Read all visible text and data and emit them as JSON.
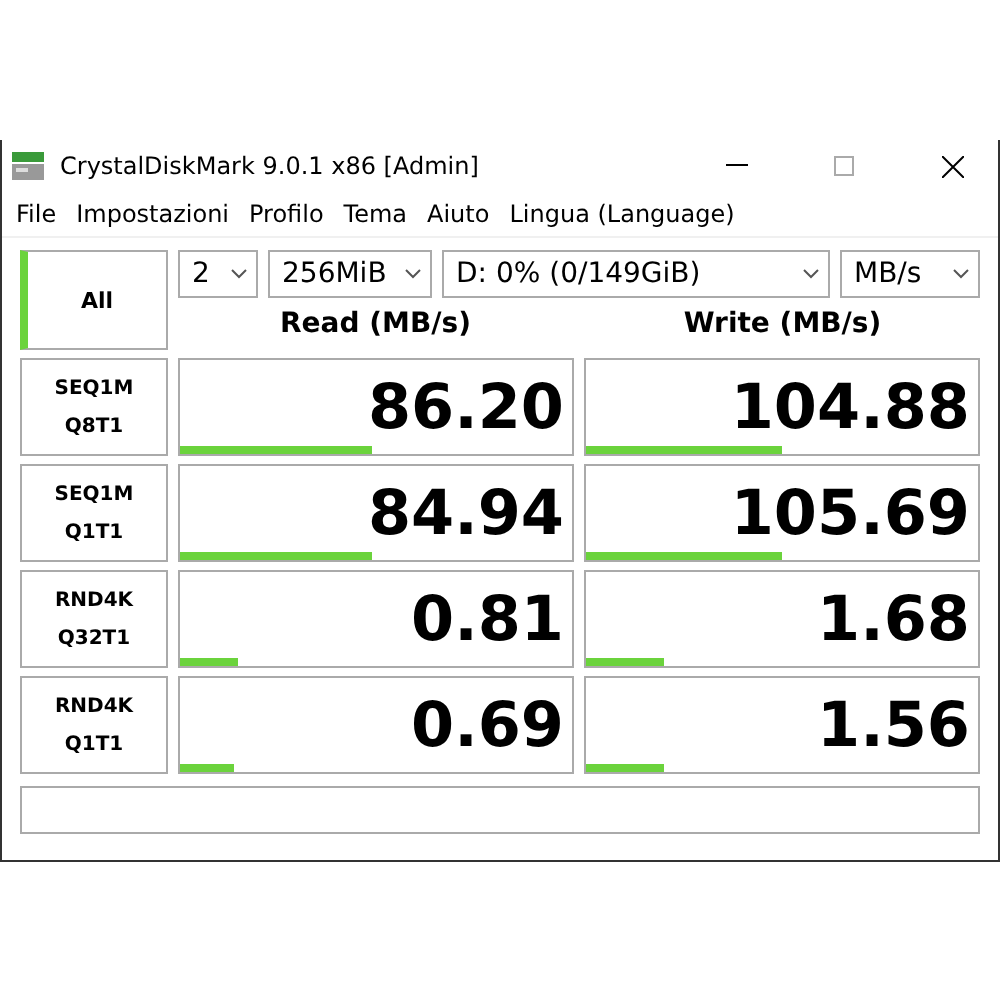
{
  "window": {
    "title": "CrystalDiskMark 9.0.1 x86 [Admin]"
  },
  "menu": [
    "File",
    "Impostazioni",
    "Profilo",
    "Tema",
    "Aiuto",
    "Lingua (Language)"
  ],
  "all_button": {
    "label": "All"
  },
  "selectors": [
    {
      "value": "2"
    },
    {
      "value": "256MiB"
    },
    {
      "value": "D: 0% (0/149GiB)"
    },
    {
      "value": "MB/s"
    }
  ],
  "columns": [
    "Read (MB/s)",
    "Write (MB/s)"
  ],
  "tests": [
    {
      "name": [
        "SEQ1M",
        "Q8T1"
      ],
      "read": {
        "value": "86.20",
        "level": 0.49
      },
      "write": {
        "value": "104.88",
        "level": 0.5
      }
    },
    {
      "name": [
        "SEQ1M",
        "Q1T1"
      ],
      "read": {
        "value": "84.94",
        "level": 0.49
      },
      "write": {
        "value": "105.69",
        "level": 0.5
      }
    },
    {
      "name": [
        "RND4K",
        "Q32T1"
      ],
      "read": {
        "value": "0.81",
        "level": 0.15
      },
      "write": {
        "value": "1.68",
        "level": 0.2
      }
    },
    {
      "name": [
        "RND4K",
        "Q1T1"
      ],
      "read": {
        "value": "0.69",
        "level": 0.14
      },
      "write": {
        "value": "1.56",
        "level": 0.2
      }
    }
  ]
}
